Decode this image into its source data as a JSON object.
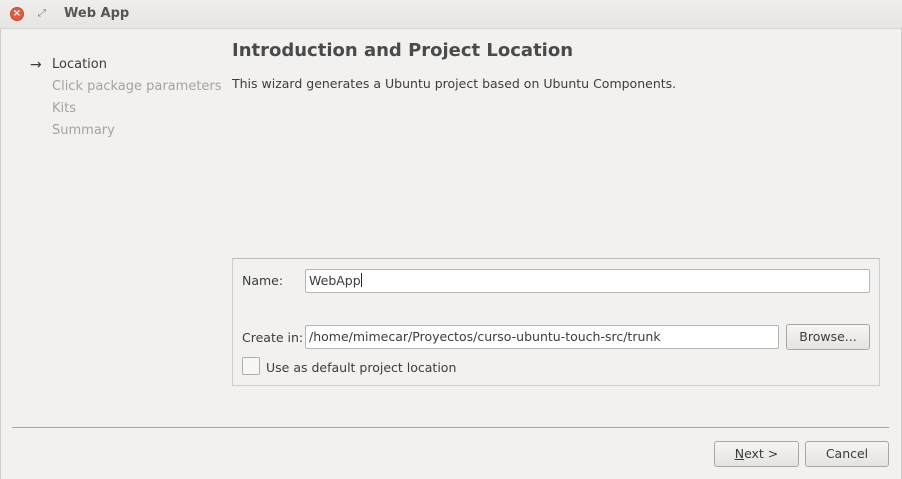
{
  "window": {
    "title": "Web App",
    "close_glyph": "×",
    "restore_glyph": "⤢"
  },
  "steps": [
    {
      "label": "Location",
      "active": true
    },
    {
      "label": "Click package parameters",
      "active": false
    },
    {
      "label": "Kits",
      "active": false
    },
    {
      "label": "Summary",
      "active": false
    }
  ],
  "page": {
    "heading": "Introduction and Project Location",
    "intro": "This wizard generates a Ubuntu project based on Ubuntu Components."
  },
  "form": {
    "name_label": "Name:",
    "name_value": "WebApp",
    "create_in_label": "Create in:",
    "create_in_value": "/home/mimecar/Proyectos/curso-ubuntu-touch-src/trunk",
    "browse_label": "Browse...",
    "default_location_label": "Use as default project location",
    "default_location_checked": false
  },
  "buttons": {
    "next_mnemonic": "N",
    "next_rest": "ext >",
    "cancel": "Cancel"
  },
  "colors": {
    "close": "#e35a45",
    "background": "#f2f1f0"
  }
}
